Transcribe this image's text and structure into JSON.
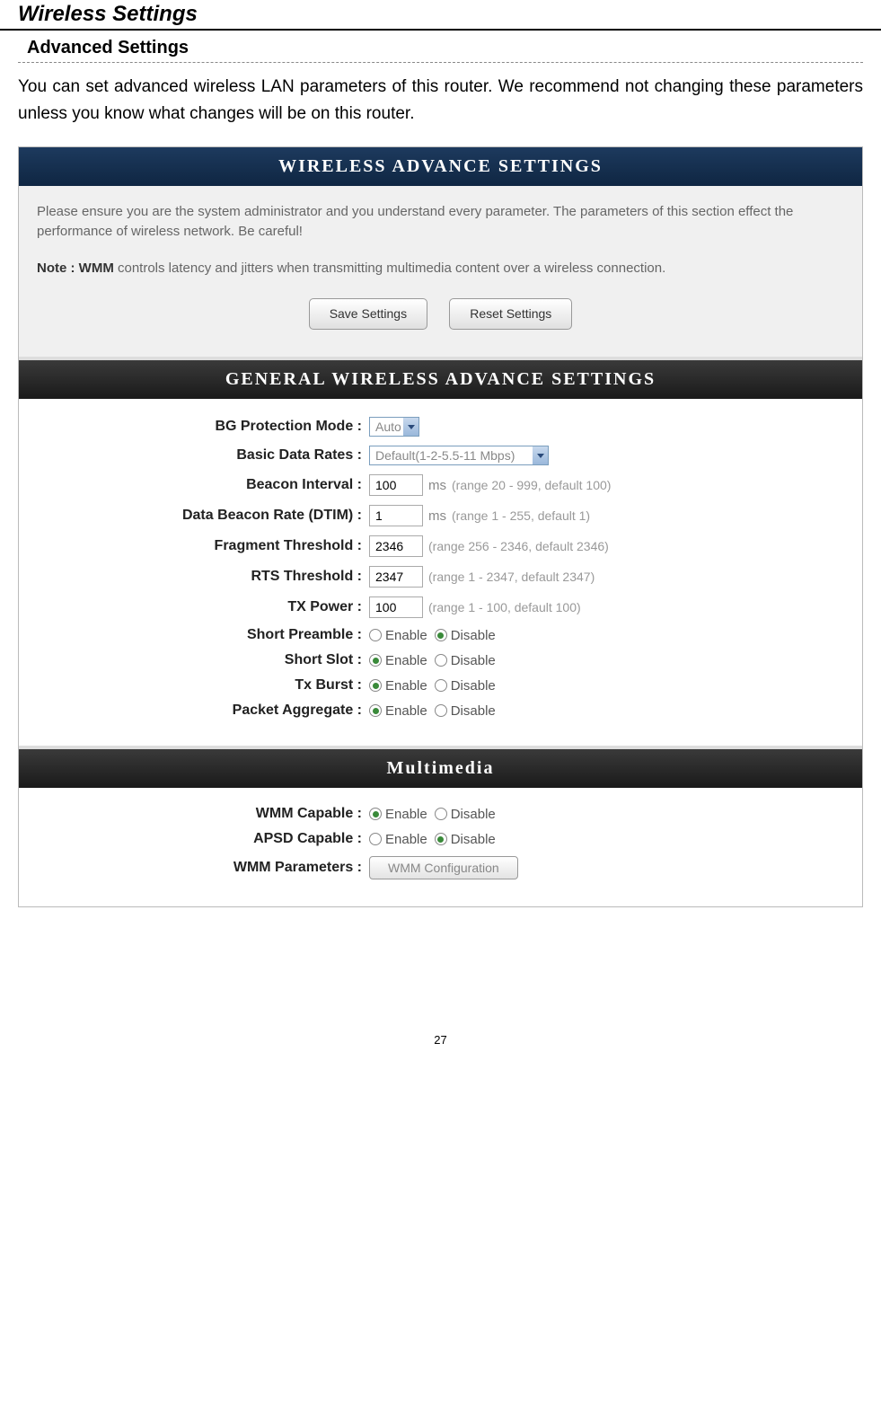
{
  "page": {
    "title": "Wireless Settings",
    "subtitle": "Advanced Settings",
    "intro": "You can set advanced wireless LAN parameters of this router. We recommend not changing these parameters unless you know what changes will be on this router.",
    "pageNumber": "27"
  },
  "panel1": {
    "header": "WIRELESS ADVANCE SETTINGS",
    "info1": "Please ensure you are the system administrator and you understand every parameter. The parameters of this section effect the performance of wireless network. Be careful!",
    "noteLabel": "Note : WMM",
    "noteText": " controls latency and jitters when transmitting multimedia content over a wireless connection.",
    "saveBtn": "Save Settings",
    "resetBtn": "Reset Settings"
  },
  "panel2": {
    "header": "GENERAL WIRELESS ADVANCE SETTINGS"
  },
  "fields": {
    "bgProtection": {
      "label": "BG Protection Mode :",
      "value": "Auto"
    },
    "basicDataRates": {
      "label": "Basic Data Rates :",
      "value": "Default(1-2-5.5-11 Mbps)"
    },
    "beaconInterval": {
      "label": "Beacon Interval :",
      "value": "100",
      "unit": "ms",
      "hint": "(range 20 - 999, default 100)"
    },
    "dtim": {
      "label": "Data Beacon Rate (DTIM) :",
      "value": "1",
      "unit": "ms",
      "hint": "(range 1 - 255, default 1)"
    },
    "fragment": {
      "label": "Fragment Threshold :",
      "value": "2346",
      "hint": "(range 256 - 2346, default 2346)"
    },
    "rts": {
      "label": "RTS Threshold :",
      "value": "2347",
      "hint": "(range 1 - 2347, default 2347)"
    },
    "txPower": {
      "label": "TX Power :",
      "value": "100",
      "hint": "(range 1 - 100, default 100)"
    },
    "shortPreamble": {
      "label": "Short Preamble :",
      "enable": "Enable",
      "disable": "Disable"
    },
    "shortSlot": {
      "label": "Short Slot :",
      "enable": "Enable",
      "disable": "Disable"
    },
    "txBurst": {
      "label": "Tx Burst :",
      "enable": "Enable",
      "disable": "Disable"
    },
    "packetAggregate": {
      "label": "Packet Aggregate :",
      "enable": "Enable",
      "disable": "Disable"
    }
  },
  "panel3": {
    "header": "Multimedia"
  },
  "multimedia": {
    "wmmCapable": {
      "label": "WMM Capable :",
      "enable": "Enable",
      "disable": "Disable"
    },
    "apsdCapable": {
      "label": "APSD Capable :",
      "enable": "Enable",
      "disable": "Disable"
    },
    "wmmParams": {
      "label": "WMM Parameters :",
      "btn": "WMM Configuration"
    }
  }
}
